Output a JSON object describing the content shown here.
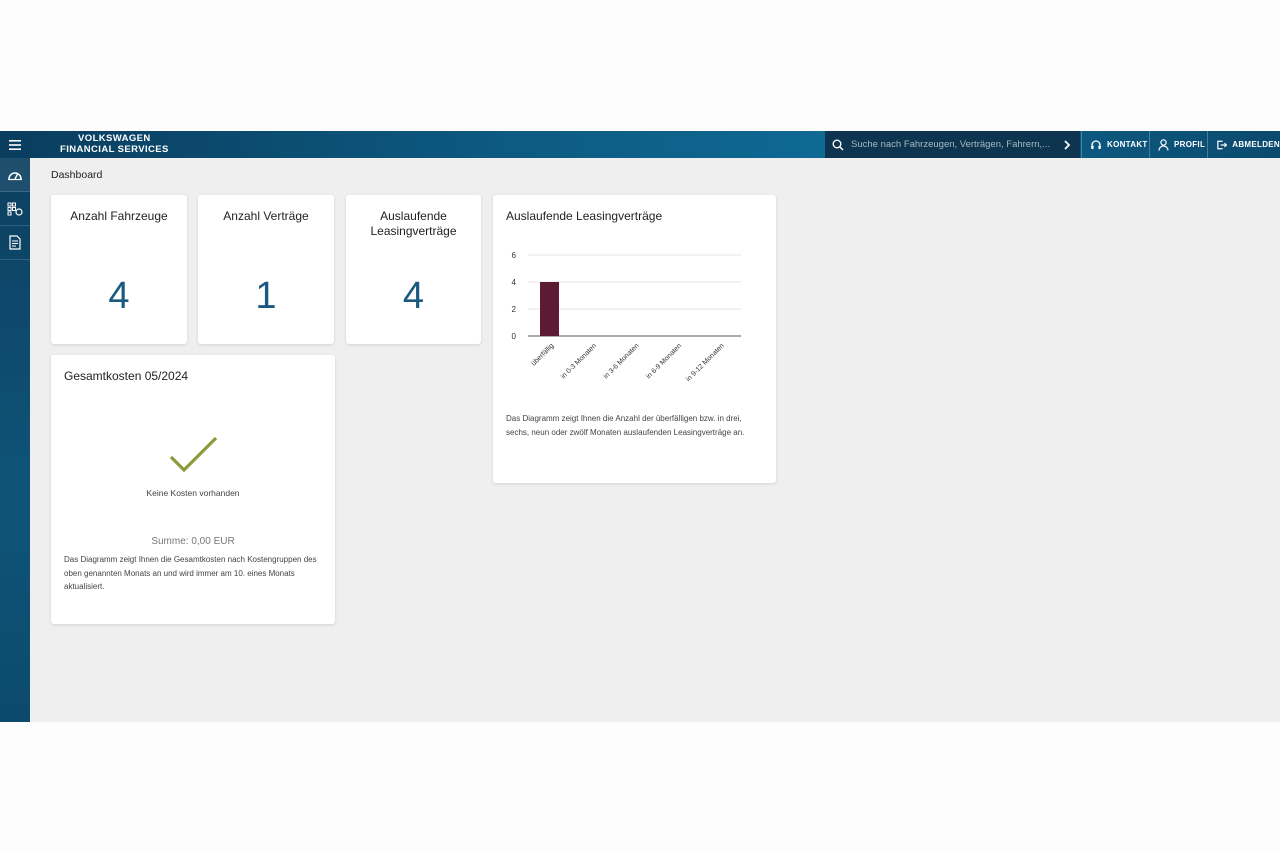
{
  "brand": {
    "line1": "VOLKSWAGEN",
    "line2": "FINANCIAL SERVICES"
  },
  "search": {
    "placeholder": "Suche nach Fahrzeugen, Verträgen, Fahrern,..."
  },
  "nav": {
    "contact": "KONTAKT",
    "profile": "PROFIL",
    "logout": "ABMELDEN"
  },
  "sidebar": {
    "items": [
      "dashboard-icon",
      "fleet-icon",
      "contracts-icon"
    ]
  },
  "breadcrumb": "Dashboard",
  "kpis": [
    {
      "title": "Anzahl Fahrzeuge",
      "value": "4"
    },
    {
      "title": "Anzahl Verträge",
      "value": "1"
    },
    {
      "title": "Auslaufende\nLeasingverträge",
      "value": "4"
    }
  ],
  "costs": {
    "title": "Gesamtkosten 05/2024",
    "status": "Keine Kosten vorhanden",
    "sum": "Summe: 0,00 EUR",
    "description": "Das Diagramm zeigt Ihnen die Gesamtkosten nach Kostengruppen des oben genannten Monats an und wird immer am 10. eines Monats aktualisiert."
  },
  "leasing": {
    "title": "Auslaufende Leasingverträge",
    "description": "Das Diagramm zeigt Ihnen die Anzahl der überfälligen bzw. in drei, sechs, neun oder zwölf Monaten auslaufenden Leasingverträge an."
  },
  "colors": {
    "brand": "#0f6a94",
    "bar": "#5c1a33",
    "check": "#8a9a3b",
    "kpi": "#1b5a80"
  },
  "chart_data": {
    "type": "bar",
    "categories": [
      "überfällig",
      "in 0-3 Monaten",
      "in 3-6 Monaten",
      "in 6-9 Monaten",
      "in 9-12 Monaten"
    ],
    "values": [
      4,
      0,
      0,
      0,
      0
    ],
    "yticks": [
      0,
      2,
      4,
      6
    ],
    "ylim": [
      0,
      6
    ],
    "grid": true
  }
}
